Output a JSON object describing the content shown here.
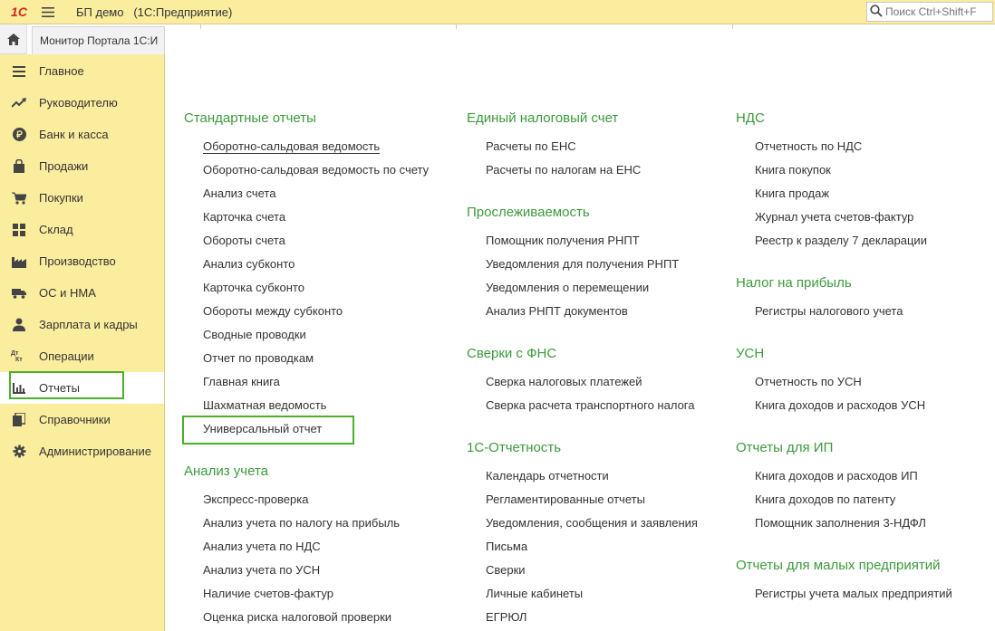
{
  "app": {
    "logo_text": "1С",
    "title": "БП демо",
    "subtitle": "(1С:Предприятие)"
  },
  "search": {
    "placeholder": "Поиск Ctrl+Shift+F"
  },
  "tabs": {
    "portal": "Монитор Портала 1С:И"
  },
  "sidebar": {
    "items": [
      {
        "label": "Главное",
        "icon": "menu-icon"
      },
      {
        "label": "Руководителю",
        "icon": "trend-icon"
      },
      {
        "label": "Банк и касса",
        "icon": "ruble-icon"
      },
      {
        "label": "Продажи",
        "icon": "bag-icon"
      },
      {
        "label": "Покупки",
        "icon": "cart-icon"
      },
      {
        "label": "Склад",
        "icon": "grid-icon"
      },
      {
        "label": "Производство",
        "icon": "factory-icon"
      },
      {
        "label": "ОС и НМА",
        "icon": "truck-icon"
      },
      {
        "label": "Зарплата и кадры",
        "icon": "person-icon"
      },
      {
        "label": "Операции",
        "icon": "dt-kt-icon",
        "icon_text_top": "Дт",
        "icon_text_bottom": "Кт"
      },
      {
        "label": "Отчеты",
        "icon": "bar-chart-icon"
      },
      {
        "label": "Справочники",
        "icon": "books-icon"
      },
      {
        "label": "Администрирование",
        "icon": "gear-icon"
      }
    ],
    "active": "Отчеты"
  },
  "sections": {
    "standard": {
      "title": "Стандартные отчеты",
      "links": [
        "Оборотно-сальдовая ведомость",
        "Оборотно-сальдовая ведомость по счету",
        "Анализ счета",
        "Карточка счета",
        "Обороты счета",
        "Анализ субконто",
        "Карточка субконто",
        "Обороты между субконто",
        "Сводные проводки",
        "Отчет по проводкам",
        "Главная книга",
        "Шахматная ведомость",
        "Универсальный отчет"
      ]
    },
    "analysis": {
      "title": "Анализ учета",
      "links": [
        "Экспресс-проверка",
        "Анализ учета по налогу на прибыль",
        "Анализ учета по НДС",
        "Анализ учета по УСН",
        "Наличие счетов-фактур",
        "Оценка риска налоговой проверки"
      ]
    },
    "ens": {
      "title": "Единый налоговый счет",
      "links": [
        "Расчеты по ЕНС",
        "Расчеты по налогам на ЕНС"
      ]
    },
    "trace": {
      "title": "Прослеживаемость",
      "links": [
        "Помощник получения РНПТ",
        "Уведомления для получения РНПТ",
        "Уведомления о перемещении",
        "Анализ РНПТ документов"
      ]
    },
    "fns": {
      "title": "Сверки с ФНС",
      "links": [
        "Сверка налоговых платежей",
        "Сверка расчета транспортного налога"
      ]
    },
    "reporting": {
      "title": "1С-Отчетность",
      "links": [
        "Календарь отчетности",
        "Регламентированные отчеты",
        "Уведомления, сообщения и заявления",
        "Письма",
        "Сверки",
        "Личные кабинеты",
        "ЕГРЮЛ"
      ]
    },
    "vat": {
      "title": "НДС",
      "links": [
        "Отчетность по НДС",
        "Книга покупок",
        "Книга продаж",
        "Журнал учета счетов-фактур",
        "Реестр к разделу 7 декларации"
      ]
    },
    "profit": {
      "title": "Налог на прибыль",
      "links": [
        "Регистры налогового учета"
      ]
    },
    "usn": {
      "title": "УСН",
      "links": [
        "Отчетность по УСН",
        "Книга доходов и расходов УСН"
      ]
    },
    "ip": {
      "title": "Отчеты для ИП",
      "links": [
        "Книга доходов и расходов ИП",
        "Книга доходов по патенту",
        "Помощник заполнения 3-НДФЛ"
      ]
    },
    "small": {
      "title": "Отчеты для малых предприятий",
      "links": [
        "Регистры учета малых предприятий"
      ]
    }
  },
  "colors": {
    "accent_green": "#3c9a3c",
    "highlight": "#4caf2a",
    "panel": "#fbed9e"
  }
}
